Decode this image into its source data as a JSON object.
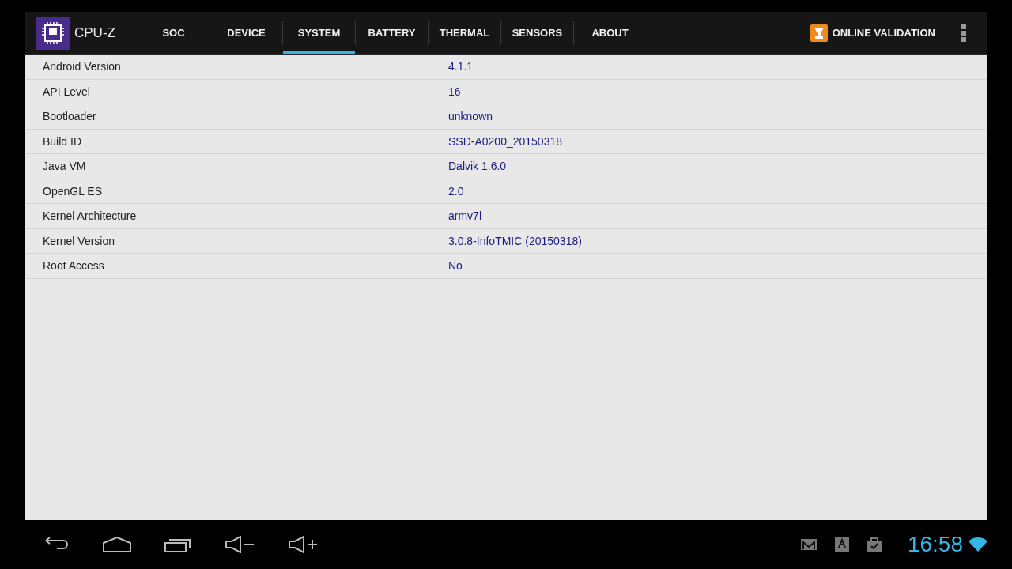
{
  "app": {
    "title": "CPU-Z"
  },
  "tabs": [
    {
      "label": "SOC",
      "selected": false
    },
    {
      "label": "DEVICE",
      "selected": false
    },
    {
      "label": "SYSTEM",
      "selected": true
    },
    {
      "label": "BATTERY",
      "selected": false
    },
    {
      "label": "THERMAL",
      "selected": false
    },
    {
      "label": "SENSORS",
      "selected": false
    },
    {
      "label": "ABOUT",
      "selected": false
    }
  ],
  "validation_button": {
    "label": "ONLINE VALIDATION"
  },
  "rows": [
    {
      "label": "Android Version",
      "value": "4.1.1"
    },
    {
      "label": "API Level",
      "value": "16"
    },
    {
      "label": "Bootloader",
      "value": "unknown"
    },
    {
      "label": "Build ID",
      "value": "SSD-A0200_20150318"
    },
    {
      "label": "Java VM",
      "value": "Dalvik 1.6.0"
    },
    {
      "label": "OpenGL ES",
      "value": "2.0"
    },
    {
      "label": "Kernel Architecture",
      "value": "armv7l"
    },
    {
      "label": "Kernel Version",
      "value": "3.0.8-InfoTMIC (20150318)"
    },
    {
      "label": "Root Access",
      "value": "No"
    }
  ],
  "status_bar": {
    "time": "16:58"
  }
}
